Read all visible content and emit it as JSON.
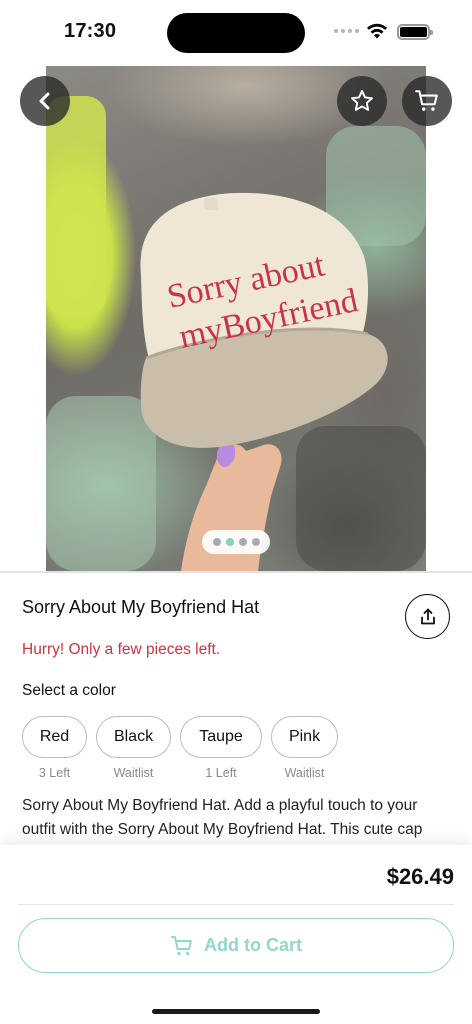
{
  "status_bar": {
    "time": "17:30"
  },
  "hero": {
    "cap_text_line1": "Sorry about",
    "cap_text_line2": "myBoyfriend",
    "pager": {
      "total": 4,
      "active_index": 1
    }
  },
  "icons": {
    "back": "chevron-left-icon",
    "favorite": "star-icon",
    "cart": "cart-icon",
    "share": "share-icon"
  },
  "product": {
    "title": "Sorry About My Boyfriend Hat",
    "stock_warning": "Hurry! Only a few pieces left.",
    "color_label": "Select a color",
    "colors": [
      {
        "name": "Red",
        "availability": "3 Left"
      },
      {
        "name": "Black",
        "availability": "Waitlist"
      },
      {
        "name": "Taupe",
        "availability": "1 Left"
      },
      {
        "name": "Pink",
        "availability": "Waitlist"
      }
    ],
    "description": "Sorry About My Boyfriend Hat. Add a playful touch to your outfit with the Sorry About My Boyfriend Hat. This cute cap features embroidered wording that makes a fun statement."
  },
  "checkout": {
    "price": "$26.49",
    "add_to_cart_label": "Add to Cart"
  },
  "colors": {
    "accent": "#8fd9c9",
    "warning": "#d0343b",
    "cap_embroidery": "#c8324a"
  }
}
